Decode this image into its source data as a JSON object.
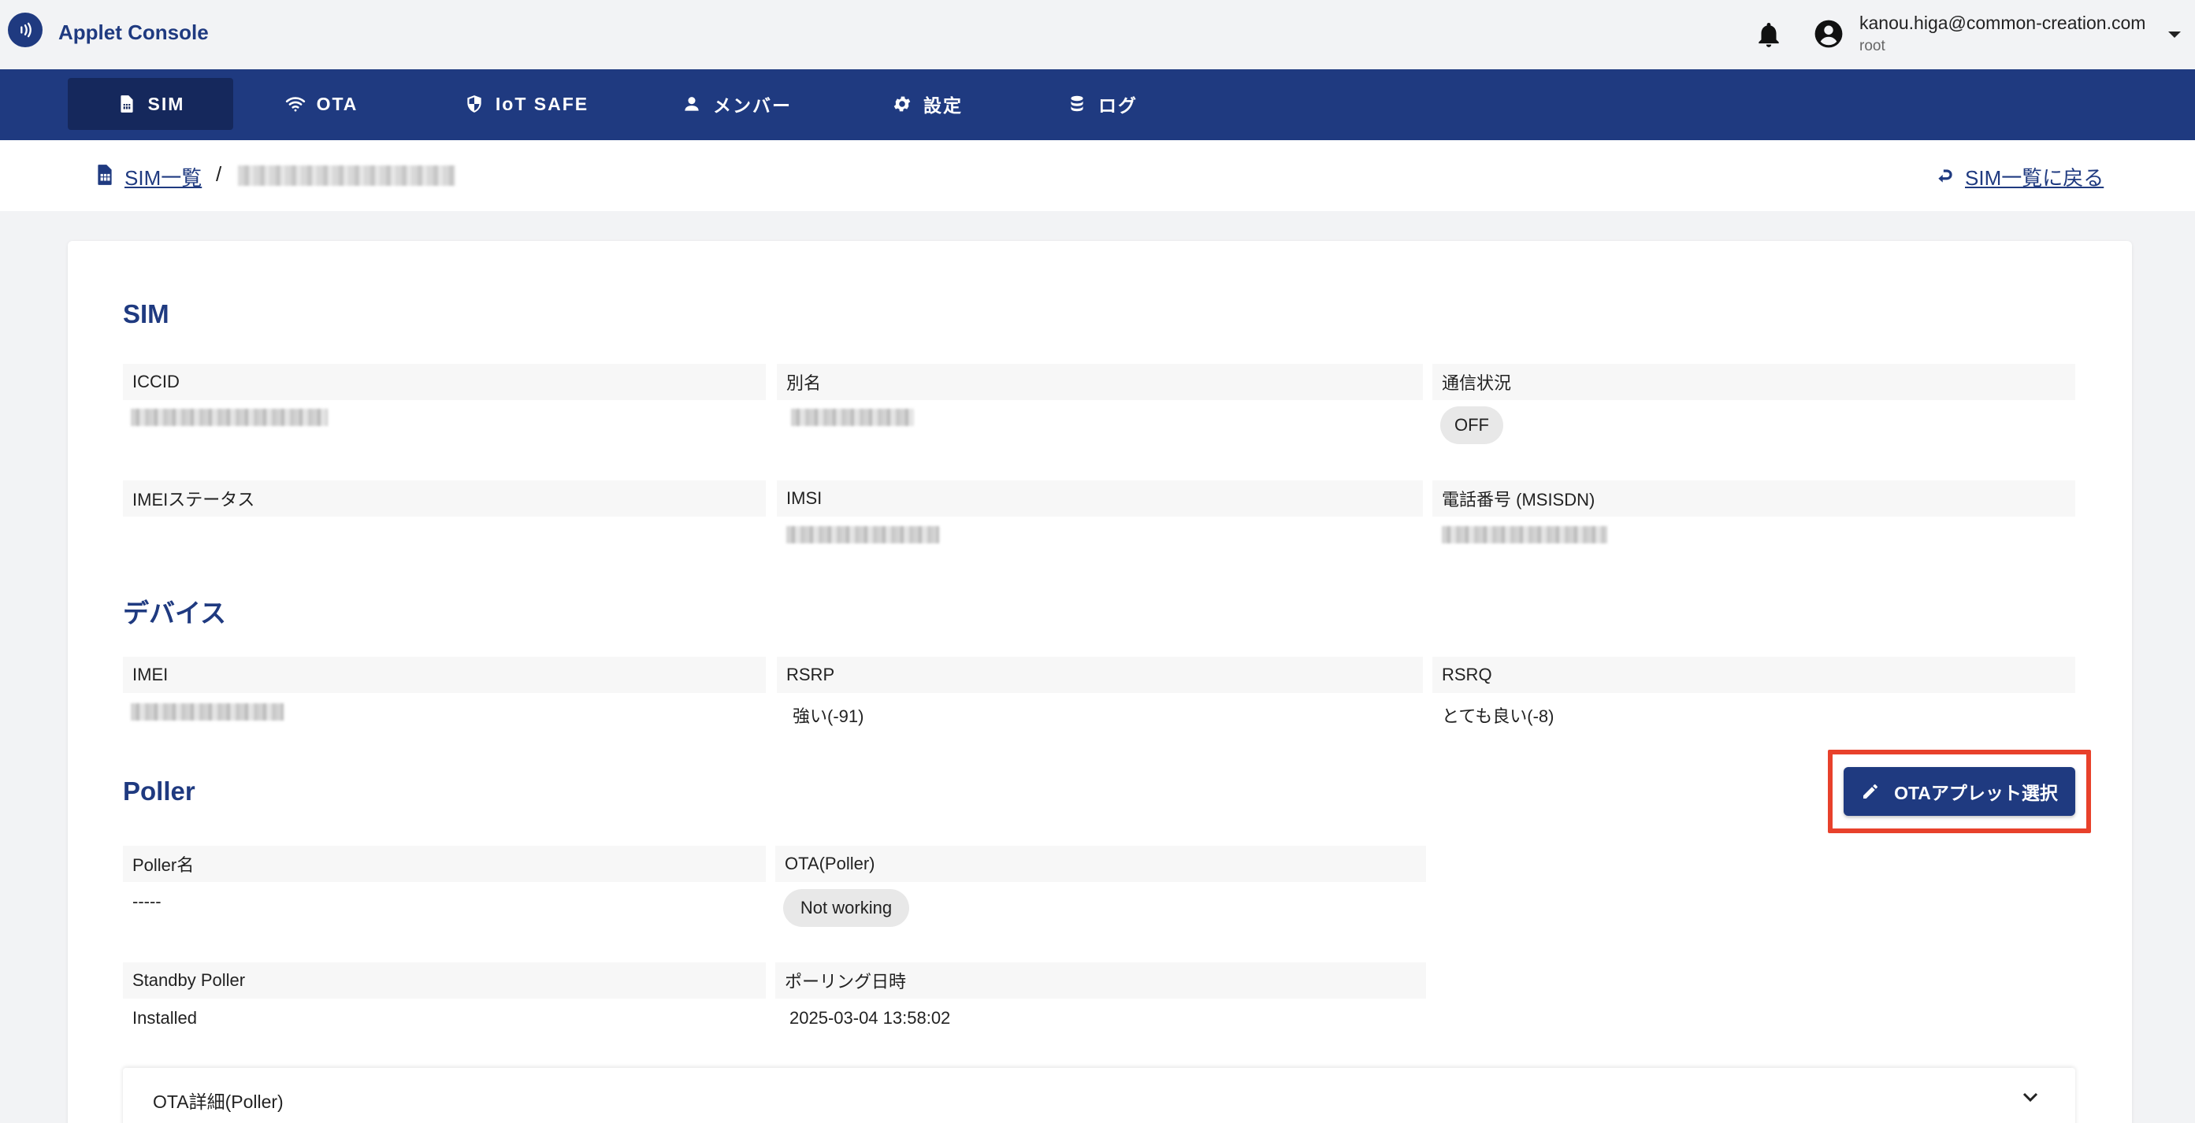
{
  "app": {
    "title": "Applet Console"
  },
  "user": {
    "email": "kanou.higa@common-creation.com",
    "role": "root"
  },
  "nav": [
    {
      "label": "SIM",
      "icon": "sim-card-icon",
      "active": true
    },
    {
      "label": "OTA",
      "icon": "wifi-icon",
      "active": false
    },
    {
      "label": "IoT SAFE",
      "icon": "shield-icon",
      "active": false
    },
    {
      "label": "メンバー",
      "icon": "person-icon",
      "active": false
    },
    {
      "label": "設定",
      "icon": "gear-icon",
      "active": false
    },
    {
      "label": "ログ",
      "icon": "database-icon",
      "active": false
    }
  ],
  "breadcrumb": {
    "link": "SIM一覧",
    "separator": "/",
    "current": "8981100000000000000",
    "back": "SIM一覧に戻る"
  },
  "sim": {
    "title": "SIM",
    "iccid_label": "ICCID",
    "iccid_value": "8981100000000000000",
    "alias_label": "別名",
    "alias_value": "test-iphone",
    "status_label": "通信状況",
    "status_value": "OFF",
    "imei_status_label": "IMEIステータス",
    "imei_status_value": "",
    "imsi_label": "IMSI",
    "imsi_value": "440100000000000",
    "msisdn_label": "電話番号 (MSISDN)",
    "msisdn_value": "0000000000000"
  },
  "device": {
    "title": "デバイス",
    "imei_label": "IMEI",
    "imei_value": "350000000000000",
    "rsrp_label": "RSRP",
    "rsrp_value": "強い(-91)",
    "rsrq_label": "RSRQ",
    "rsrq_value": "とても良い(-8)"
  },
  "poller": {
    "title": "Poller",
    "button": "OTAアプレット選択",
    "name_label": "Poller名",
    "name_value": "-----",
    "ota_label": "OTA(Poller)",
    "ota_value": "Not working",
    "standby_label": "Standby Poller",
    "standby_value": "Installed",
    "polling_label": "ポーリング日時",
    "polling_value": "2025-03-04 13:58:02",
    "accordion": "OTA詳細(Poller)"
  },
  "colors": {
    "brand": "#1f3a80",
    "nav_active": "#15285c",
    "highlight": "#e8412b"
  }
}
